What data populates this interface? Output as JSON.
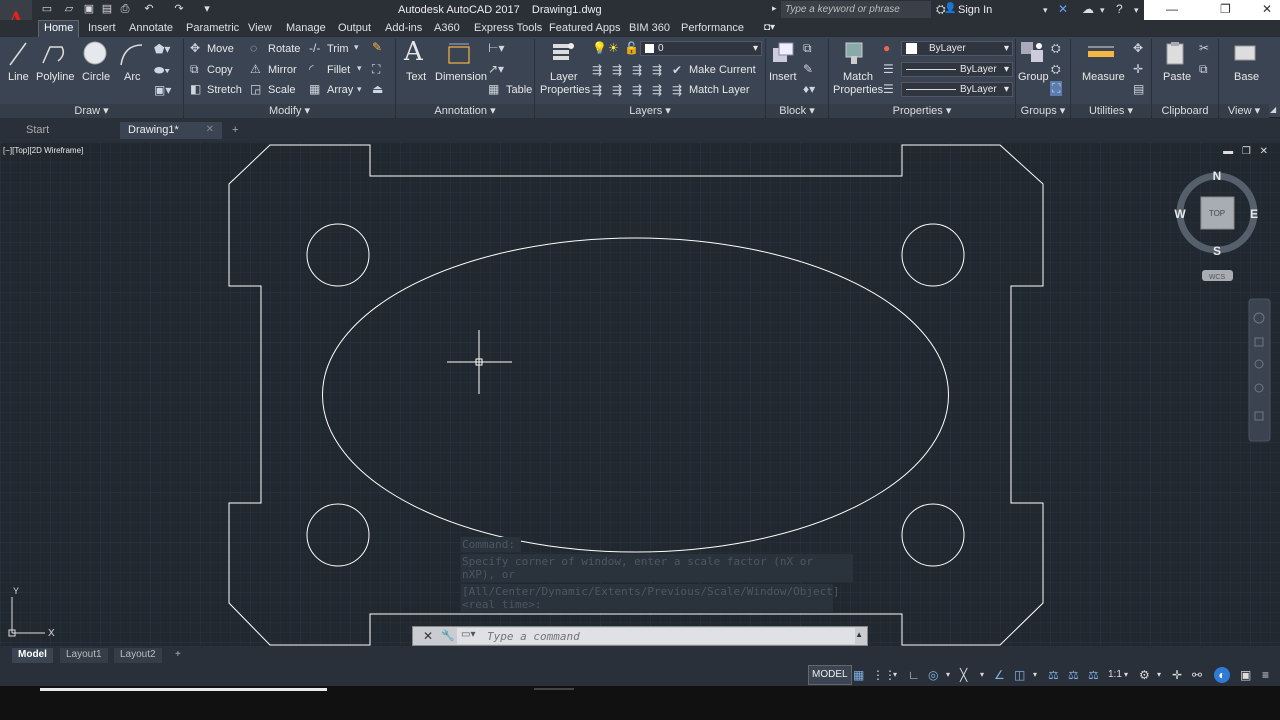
{
  "app": {
    "window_title": "Autodesk AutoCAD 2017    Drawing1.dwg",
    "app_button_letter": "A",
    "search_placeholder": "Type a keyword or phrase",
    "sign_in": "Sign In"
  },
  "ribbon_tabs": [
    "Home",
    "Insert",
    "Annotate",
    "Parametric",
    "View",
    "Manage",
    "Output",
    "Add-ins",
    "A360",
    "Express Tools",
    "Featured Apps",
    "BIM 360",
    "Performance"
  ],
  "ribbon": {
    "draw": {
      "title": "Draw",
      "line": "Line",
      "polyline": "Polyline",
      "circle": "Circle",
      "arc": "Arc"
    },
    "modify": {
      "title": "Modify",
      "move": "Move",
      "rotate": "Rotate",
      "trim": "Trim",
      "copy": "Copy",
      "mirror": "Mirror",
      "fillet": "Fillet",
      "stretch": "Stretch",
      "scale": "Scale",
      "array": "Array"
    },
    "annotation": {
      "title": "Annotation",
      "text": "Text",
      "dimension": "Dimension",
      "table": "Table"
    },
    "layers": {
      "title": "Layers",
      "layer_properties_1": "Layer",
      "layer_properties_2": "Properties",
      "current_layer": "0",
      "make_current": "Make Current",
      "match_layer": "Match Layer"
    },
    "block": {
      "title": "Block",
      "insert": "Insert"
    },
    "properties": {
      "title": "Properties",
      "match_1": "Match",
      "match_2": "Properties",
      "color": "ByLayer",
      "linetype": "ByLayer",
      "lineweight": "ByLayer"
    },
    "groups": {
      "title": "Groups",
      "group": "Group"
    },
    "utilities": {
      "title": "Utilities",
      "measure": "Measure"
    },
    "clipboard": {
      "title": "Clipboard",
      "paste": "Paste"
    },
    "view": {
      "title": "View",
      "base": "Base"
    }
  },
  "file_tabs": [
    "Start",
    "Drawing1*"
  ],
  "viewport": {
    "label": "[−][Top][2D Wireframe]",
    "viewcube": {
      "n": "N",
      "s": "S",
      "e": "E",
      "w": "W",
      "face": "TOP",
      "wcs": "WCS"
    },
    "ucs": {
      "x": "X",
      "y": "Y"
    }
  },
  "command": {
    "history": [
      "Command:",
      "Specify corner of window, enter a scale factor (nX or nXP), or",
      "[All/Center/Dynamic/Extents/Previous/Scale/Window/Object] <real time>:"
    ],
    "placeholder": "Type a command"
  },
  "layout_tabs": [
    "Model",
    "Layout1",
    "Layout2"
  ],
  "status": {
    "model": "MODEL",
    "scale": "1:1"
  },
  "colors": {
    "background": "#212830",
    "ribbon": "#3b4452",
    "geometry": "#ffffff",
    "accent_red": "#e2231a"
  }
}
